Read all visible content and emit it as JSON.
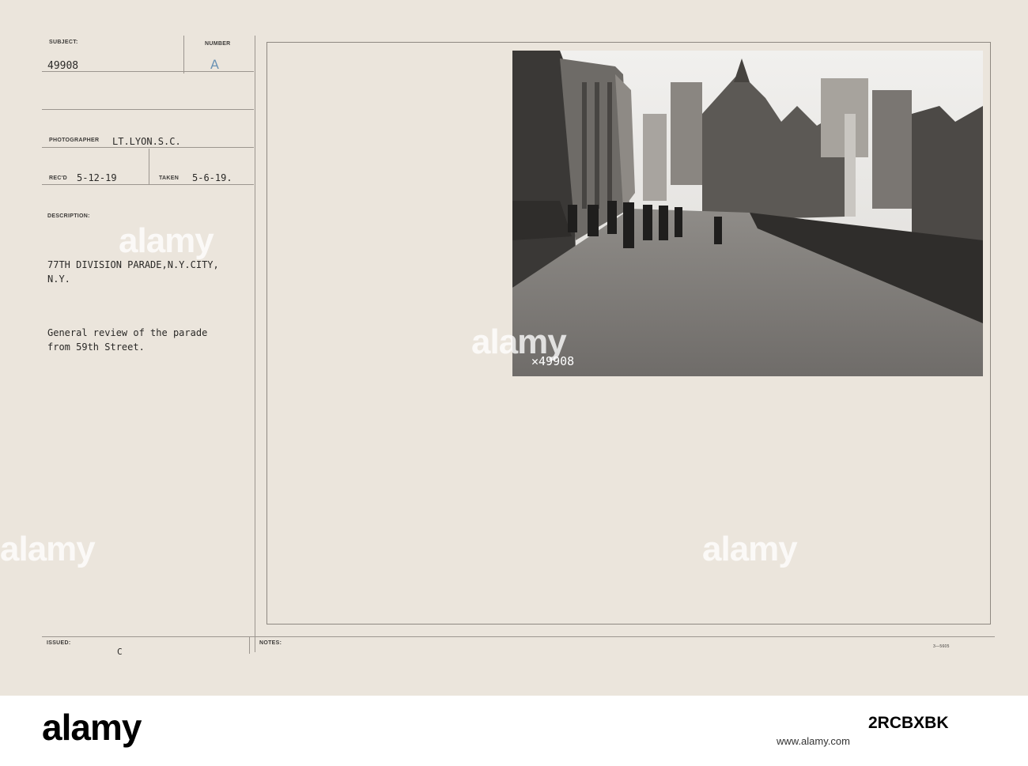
{
  "card": {
    "subject_label": "SUBJECT:",
    "subject_value": "49908",
    "number_label": "NUMBER",
    "number_value": "A",
    "photographer_label": "PHOTOGRAPHER",
    "photographer_value": "LT.LYON.S.C.",
    "recd_label": "REC'D",
    "recd_value": "5-12-19",
    "taken_label": "TAKEN",
    "taken_value": "5-6-19.",
    "description_label": "DESCRIPTION:",
    "description_line1": "77TH DIVISION PARADE,N.Y.CITY,",
    "description_line2": "N.Y.",
    "review_line1": "General review of the parade",
    "review_line2": "from 59th Street.",
    "issued_label": "ISSUED:",
    "issued_value": "C",
    "notes_label": "NOTES:",
    "form_number": "3—5605"
  },
  "photo": {
    "negative_number": "✕49908",
    "watermark": "alamy"
  },
  "watermark": "alamy",
  "bottom_bar": {
    "logo": "alamy",
    "image_id": "2RCBXBK",
    "image_sub": "www.alamy.com"
  }
}
